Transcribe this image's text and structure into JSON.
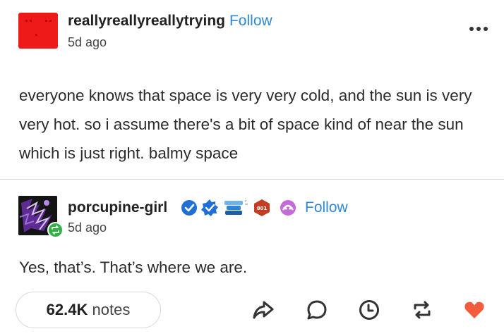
{
  "post": {
    "username": "reallyreallyreallytrying",
    "follow_label": "Follow",
    "time": "5d ago",
    "body": "everyone knows that space is very very cold, and the sun is very very hot. so i assume there's a bit of space kind of near the sun which is just right. balmy space"
  },
  "reblog": {
    "username": "porcupine-girl",
    "follow_label": "Follow",
    "time": "5d ago",
    "body": "Yes, that’s. That’s where we are.",
    "badge_text": "801"
  },
  "footer": {
    "notes_count": "62.4K",
    "notes_label": "notes",
    "icons": [
      "share-icon",
      "reply-icon",
      "schedule-icon",
      "reblog-icon",
      "like-icon"
    ]
  },
  "colors": {
    "follow_blue": "#2f88d6",
    "avatar_red": "#ee1a1a",
    "like_red": "#f25c3c",
    "reblog_green": "#2fb145"
  }
}
